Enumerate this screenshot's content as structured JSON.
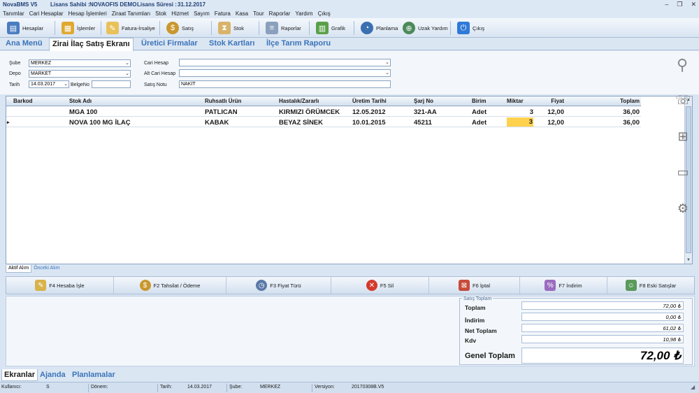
{
  "titlebar": {
    "app": "NovaBMS V5",
    "license_owner_label": "Lisans Sahibi :",
    "license_owner": "NOVAOFIS DEMO",
    "license_period_label": "Lisans Süresi :",
    "license_period": "31.12.2017"
  },
  "menu": [
    "Tanımlar",
    "Cari Hesaplar",
    "Hesap İşlemleri",
    "Ziraat Tanımları",
    "Stok",
    "Hizmet",
    "Sayım",
    "Fatura",
    "Kasa",
    "Tour",
    "Raporlar",
    "Yardım",
    "Çıkış"
  ],
  "toolbar": {
    "hesaplar": "Hesaplar",
    "islemler": "İşlemler",
    "fatura": "Fatura-İrsaliye",
    "satis": "Satış",
    "stok": "Stok",
    "raporlar": "Raporlar",
    "grafik": "Grafik",
    "planlama": "Planlama",
    "uzak": "Uzak Yardım",
    "cikis": "Çıkış"
  },
  "tabs": [
    "Ana Menü",
    "Zirai İlaç Satış Ekranı",
    "Üretici Firmalar",
    "Stok Kartları",
    "İlçe Tarım Raporu"
  ],
  "form": {
    "sube_label": "Şube",
    "sube": "MERKEZ",
    "depo_label": "Depo",
    "depo": "MARKET",
    "tarih_label": "Tarih",
    "tarih": "14.03.2017",
    "belge_label": "BelgeNo",
    "belge": "",
    "cari_label": "Cari Hesap",
    "cari": "",
    "altcari_label": "Alt Cari Hesap",
    "altcari": "",
    "not_label": "Satış Notu",
    "not": "NAKİT"
  },
  "grid": {
    "columns": [
      "Barkod",
      "Stok Adı",
      "Ruhsatlı Ürün",
      "Hastalık/Zararlı",
      "Üretim Tarihi",
      "Şarj No",
      "Birim",
      "Miktar",
      "Fiyat",
      "Toplam"
    ],
    "rows": [
      {
        "barkod": "",
        "stok": "MGA 100",
        "urun": "PATLICAN",
        "hastalik": "KIRMIZI ÖRÜMCEK",
        "tarih": "12.05.2012",
        "sarj": "321-AA",
        "birim": "Adet",
        "miktar": "3",
        "fiyat": "12,00",
        "toplam": "36,00"
      },
      {
        "barkod": "",
        "stok": "NOVA 100 MG İLAÇ",
        "urun": "KABAK",
        "hastalik": "BEYAZ SİNEK",
        "tarih": "10.01.2015",
        "sarj": "45211",
        "birim": "Adet",
        "miktar": "3",
        "fiyat": "12,00",
        "toplam": "36,00"
      }
    ]
  },
  "subtabs": [
    "Aktif Alım",
    "Önceki Alım"
  ],
  "actions": [
    "F4 Hesaba İşle",
    "F2 Tahsilat / Ödeme",
    "F3 Fiyat Türü",
    "F5 Sil",
    "F6 İptal",
    "F7 İndirim",
    "F8 Eski Satışlar"
  ],
  "totals": {
    "title": "Satış Toplam",
    "toplam_label": "Toplam",
    "toplam": "72,00 ₺",
    "indirim_label": "İndirim",
    "indirim": "0,00 ₺",
    "net_label": "Net Toplam",
    "net": "61,02 ₺",
    "kdv_label": "Kdv",
    "kdv": "10,98 ₺",
    "genel_label": "Genel Toplam",
    "genel": "72,00 ₺"
  },
  "bottomtabs": [
    "Ekranlar",
    "Ajanda",
    "Planlamalar"
  ],
  "status": {
    "kullanici_label": "Kullanıcı:",
    "kullanici": "S",
    "donem_label": "Dönem:",
    "donem": "",
    "tarih_label": "Tarih:",
    "tarih": "14.03.2017",
    "sube_label": "Şube:",
    "sube": "MERKEZ",
    "versiyon_label": "Versiyon:",
    "versiyon": "20170308B.V5"
  }
}
